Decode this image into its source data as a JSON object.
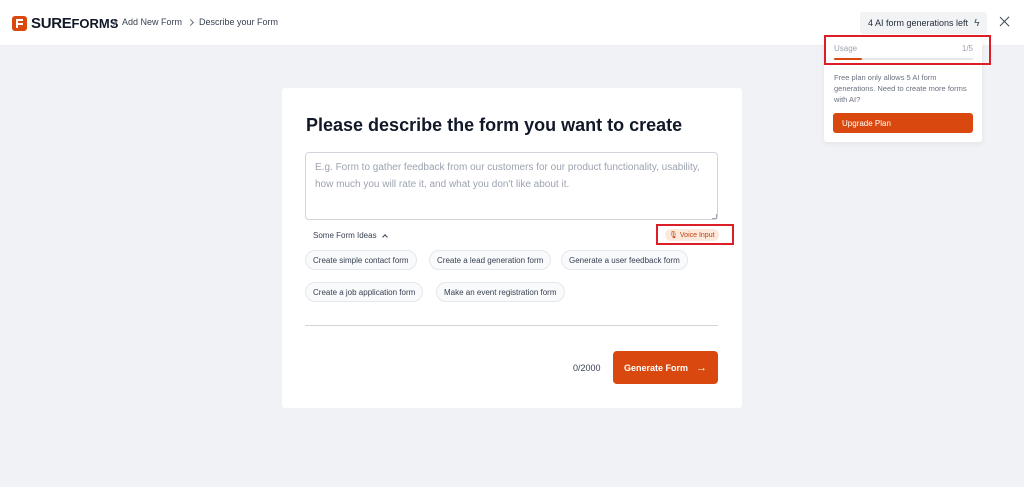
{
  "header": {
    "logo_main": "SURE",
    "logo_sub": "FORMS",
    "breadcrumbs": [
      "Add New Form",
      "Describe your Form"
    ],
    "generations_label": "4 AI form generations left",
    "generations_icon": "lightning-icon",
    "close_icon": "close-icon"
  },
  "usage": {
    "label": "Usage",
    "count": "1/5",
    "used": 1,
    "total": 5,
    "note": "Free plan only allows 5 AI form generations. Need to create more forms with AI?",
    "upgrade_label": "Upgrade Plan"
  },
  "form": {
    "title": "Please describe the form you want to create",
    "placeholder": "E.g. Form to gather feedback from our customers for our product functionality, usability, how much you will rate it, and what you don't like about it.",
    "value": "",
    "ideas_label": "Some Form Ideas",
    "voice_label": "Voice Input",
    "voice_icon": "microphone-icon",
    "ideas": [
      "Create simple contact form",
      "Create a lead generation form",
      "Generate a user feedback form",
      "Create a job application form",
      "Make an event registration form"
    ],
    "counter": "0/2000",
    "generate_label": "Generate Form",
    "generate_icon": "arrow-right-icon"
  },
  "colors": {
    "accent": "#d9480f",
    "highlight": "#dc1f26",
    "background": "#f1f2f6"
  }
}
